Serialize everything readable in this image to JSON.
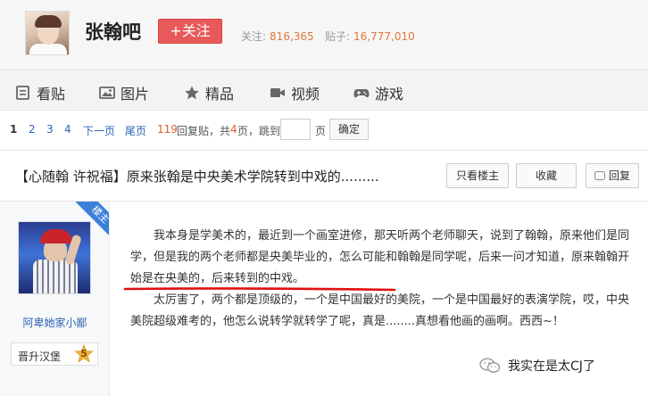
{
  "header": {
    "forum_name": "张翰吧",
    "follow_button": "+关注",
    "follow_label": "关注:",
    "follow_count": "816,365",
    "posts_label": "贴子:",
    "posts_count": "16,777,010",
    "accent_color": "#e85a5a"
  },
  "nav": {
    "items": [
      {
        "label": "看贴",
        "icon": "document-icon"
      },
      {
        "label": "图片",
        "icon": "image-icon"
      },
      {
        "label": "精品",
        "icon": "star-icon"
      },
      {
        "label": "视频",
        "icon": "video-icon"
      },
      {
        "label": "游戏",
        "icon": "gamepad-icon"
      }
    ]
  },
  "pager": {
    "pages": [
      "1",
      "2",
      "3",
      "4"
    ],
    "current_page": "1",
    "next": "下一页",
    "last": "尾页",
    "reply_count": "119",
    "reply_suffix": "回复贴，共",
    "total_pages": "4",
    "pages_suffix": "页，跳到",
    "page_unit": "页",
    "go_button": "确定",
    "jump_input_value": ""
  },
  "thread": {
    "title": "【心随翰 许祝福】原来张翰是中央美术学院转到中戏的.........",
    "only_op_button": "只看楼主",
    "favorite_button": "收藏",
    "reply_button": "回复"
  },
  "post": {
    "op_tag": "楼主",
    "author_name": "阿卑她家小鄙",
    "level_name": "晋升汉堡",
    "level_number": "5",
    "paragraph1_a": "我本身是学美术的，最近到一个画室进修，那天听两个老师聊天，说到了翰翰，原来他们是同学，但是我的两个老师都是央美毕业的，怎么可能和翰翰是同学呢，后来一问才知道，",
    "paragraph1_b": "原来翰翰开始是在央美的，后来转到的中戏。",
    "paragraph2": "太厉害了，两个都是顶级的，一个是中国最好的美院，一个是中国最好的表演学院，哎，中央美院超级难考的，他怎么说转学就转学了呢，真是........真想看他画的画啊。西西~！",
    "underline_color": "#e01010"
  },
  "watermark": {
    "text": "我实在是太CJ了",
    "icon": "wechat-icon"
  }
}
